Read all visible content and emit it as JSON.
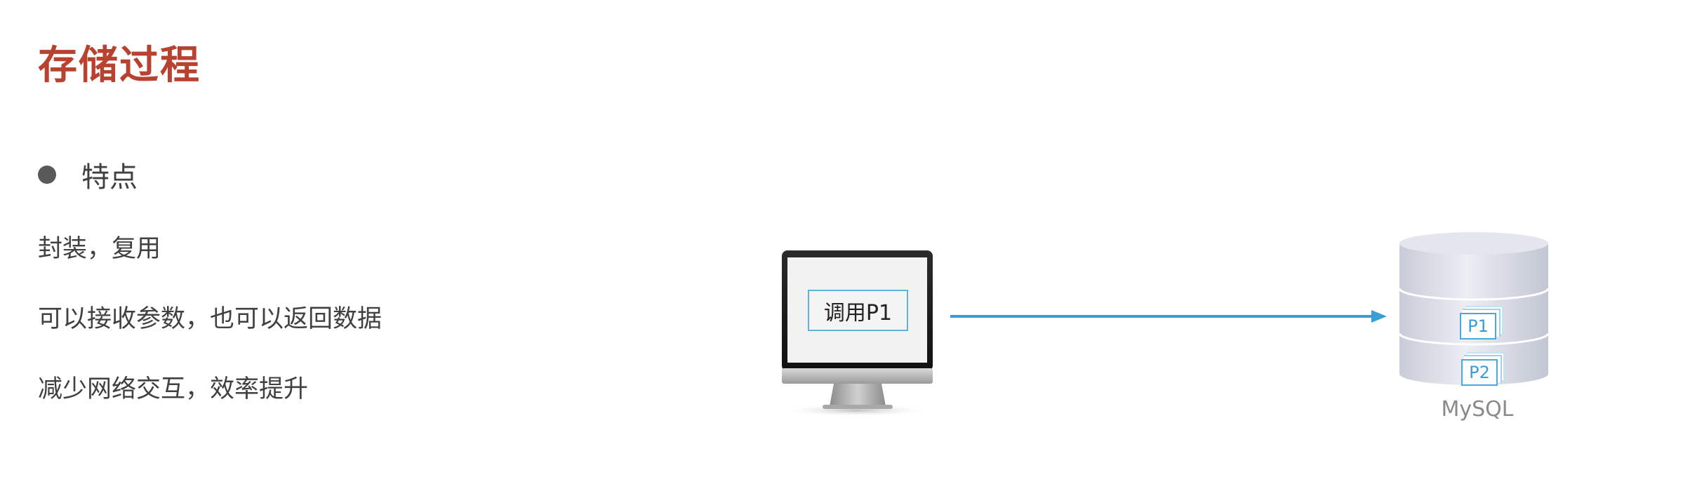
{
  "slide": {
    "title": "存储过程",
    "bullet": "特点",
    "lines": [
      "封装，复用",
      "可以接收参数，也可以返回数据",
      "减少网络交互，效率提升"
    ]
  },
  "diagram": {
    "call_label": "调用P1",
    "database_label": "MySQL",
    "procedures": [
      "P1",
      "P2"
    ],
    "arrow_color": "#3a9dd6"
  },
  "colors": {
    "title": "#b9412f",
    "text": "#404040",
    "accent": "#3a9dd6"
  }
}
